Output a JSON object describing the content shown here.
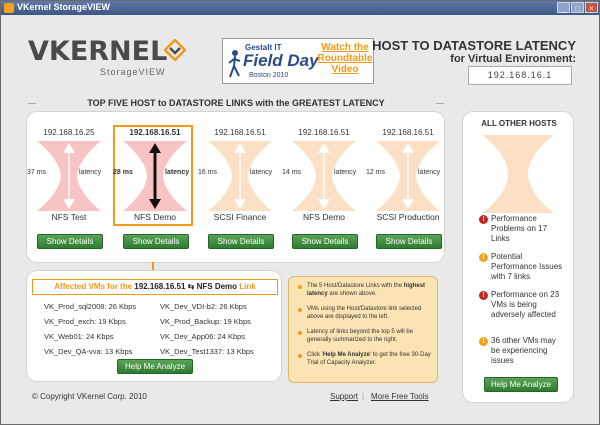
{
  "window": {
    "title": "VKernel StorageVIEW"
  },
  "brand": {
    "name": "VKERNEL",
    "product": "StorageVIEW"
  },
  "banner": {
    "org": "Gestalt IT",
    "event": "Field Day",
    "location": "Boston 2010",
    "link": "Watch the Roundtable Video"
  },
  "header": {
    "title": "HOST TO DATASTORE LATENCY",
    "subtitle": "for Virtual Environment:",
    "environment": "192.168.16.1"
  },
  "top": {
    "title": "TOP FIVE HOST to DATASTORE LINKS with the GREATEST LATENCY",
    "hosts": [
      {
        "ip": "192.168.16.25",
        "ms": "37 ms",
        "latency_label": "latency",
        "datastore": "NFS Test",
        "button": "Show Details"
      },
      {
        "ip": "192.168.16.51",
        "ms": "28 ms",
        "latency_label": "latency",
        "datastore": "NFS Demo",
        "button": "Show Details"
      },
      {
        "ip": "192.168.16.51",
        "ms": "16 ms",
        "latency_label": "latency",
        "datastore": "SCSI Finance",
        "button": "Show Details"
      },
      {
        "ip": "192.168.16.51",
        "ms": "14 ms",
        "latency_label": "latency",
        "datastore": "NFS Demo",
        "button": "Show Details"
      },
      {
        "ip": "192.168.16.51",
        "ms": "12 ms",
        "latency_label": "latency",
        "datastore": "SCSI Production",
        "button": "Show Details"
      }
    ]
  },
  "affected": {
    "prefix": "Affected VMs for the ",
    "host": "192.168.16.51",
    "arrow": "⇆",
    "datastore": "NFS Demo",
    "suffix": " Link",
    "vms_left": [
      "VK_Prod_sql2008: 26 Kbps",
      "VK_Prod_exch: 19 Kbps",
      "VK_Web01: 24 Kbps",
      "VK_Dev_QA-vva: 13 Kbps"
    ],
    "vms_right": [
      "VK_Dev_VDI-b2: 26 Kbps",
      "VK_Prod_Backup: 19 Kbps",
      "VK_Dev_App06: 24 Kbps",
      "VK_Dev_Test1337: 13 Kbps"
    ],
    "button": "Help Me Analyze"
  },
  "notes": [
    {
      "text": "The 5 Host/Datastore Links with the ",
      "bold": "highest latency",
      "after": " are shown above."
    },
    {
      "text": "VMs using the Host/Datastore link selected above are displayed to the left.",
      "bold": "",
      "after": ""
    },
    {
      "text": "Latency of links beyond the top 5 will be generally summarized to the right.",
      "bold": "",
      "after": ""
    },
    {
      "text": "Click '",
      "bold": "Help Me Analyze",
      "after": "' to get the free 30-Day Trial of Capacity Analyzer."
    }
  ],
  "other": {
    "title": "ALL OTHER HOSTS",
    "issues": [
      {
        "icon": "exclamation-icon",
        "color": "#c4271f",
        "text": "Performance Problems on 17 Links"
      },
      {
        "icon": "exclamation-icon",
        "color": "#f0a31e",
        "text": "Potential Performance Issues with 7 links"
      },
      {
        "icon": "exclamation-icon",
        "color": "#c4271f",
        "text": "Performance on 23 VMs is being adversely affected"
      },
      {
        "icon": "exclamation-icon",
        "color": "#f0a31e",
        "text": "36 other VMs may be experiencing issues"
      }
    ],
    "button": "Help Me Analyze"
  },
  "footer": {
    "copyright": "© Copyright VKernel Corp. 2010",
    "support": "Support",
    "tools": "More Free Tools"
  },
  "colors": {
    "accent": "#f29a17",
    "button_green": "#3c8c3c",
    "critical_red": "#c4271f",
    "pink": "#f7c3c3",
    "peach": "#fbe0c5"
  }
}
